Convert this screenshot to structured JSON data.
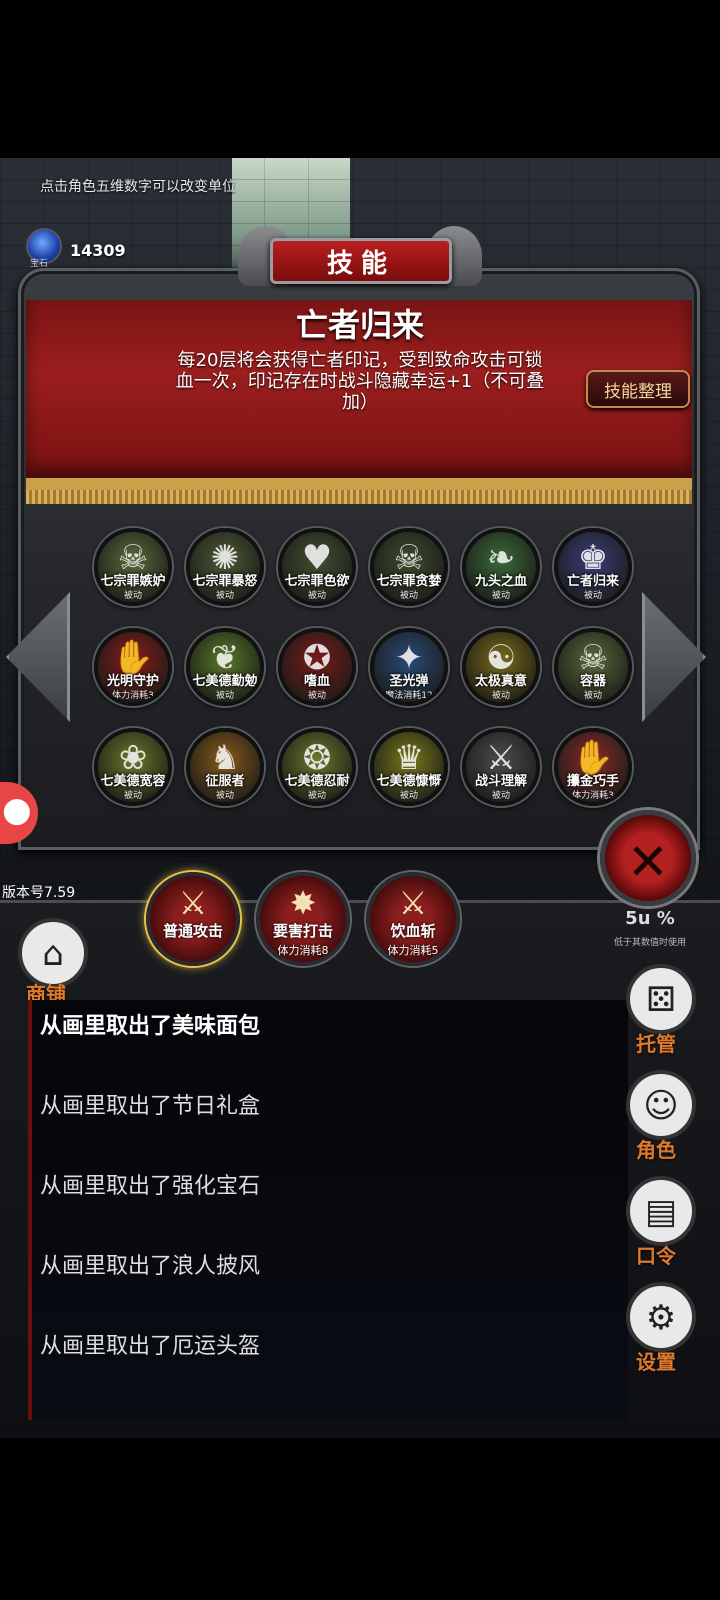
{
  "hint": "点击角色五维数字可以改变单位",
  "currency": {
    "label": "宝石",
    "amount": "14309",
    "icon": "gem-icon"
  },
  "panel": {
    "title": "技能",
    "skill_name": "亡者归来",
    "skill_desc": "每20层将会获得亡者印记，受到致命攻击可锁血一次，印记存在时战斗隐藏幸运+1（不可叠加）",
    "sort_button": "技能整理"
  },
  "skills": [
    {
      "name": "七宗罪嫉妒",
      "sub": "被动",
      "glyph": "☠",
      "color": "#5a6a3a"
    },
    {
      "name": "七宗罪暴怒",
      "sub": "被动",
      "glyph": "✺",
      "color": "#4f5a35"
    },
    {
      "name": "七宗罪色欲",
      "sub": "被动",
      "glyph": "♥",
      "color": "#445030"
    },
    {
      "name": "七宗罪贪婪",
      "sub": "被动",
      "glyph": "☠",
      "color": "#3e4a2e"
    },
    {
      "name": "九头之血",
      "sub": "被动",
      "glyph": "❧",
      "color": "#3a6a3a"
    },
    {
      "name": "亡者归来",
      "sub": "被动",
      "glyph": "♚",
      "color": "#3a3e7a"
    },
    {
      "name": "光明守护",
      "sub": "体力消耗3",
      "glyph": "✋",
      "color": "#8a1a1a"
    },
    {
      "name": "七美德勤勉",
      "sub": "被动",
      "glyph": "❦",
      "color": "#5a7a2a"
    },
    {
      "name": "嗜血",
      "sub": "被动",
      "glyph": "✪",
      "color": "#7a1a1a"
    },
    {
      "name": "圣光弹",
      "sub": "魔法消耗12",
      "glyph": "✦",
      "color": "#2a4a7a"
    },
    {
      "name": "太极真意",
      "sub": "被动",
      "glyph": "☯",
      "color": "#7a6a1a"
    },
    {
      "name": "容器",
      "sub": "被动",
      "glyph": "☠",
      "color": "#5a6a3a"
    },
    {
      "name": "七美德宽容",
      "sub": "被动",
      "glyph": "❀",
      "color": "#6a7a2a"
    },
    {
      "name": "征服者",
      "sub": "被动",
      "glyph": "♞",
      "color": "#8a5a1a"
    },
    {
      "name": "七美德忍耐",
      "sub": "被动",
      "glyph": "❂",
      "color": "#6a7a2a"
    },
    {
      "name": "七美德慷慨",
      "sub": "被动",
      "glyph": "♛",
      "color": "#7a7a1a"
    },
    {
      "name": "战斗理解",
      "sub": "被动",
      "glyph": "⚔",
      "color": "#4a4c50"
    },
    {
      "name": "攥金巧手",
      "sub": "体力消耗3",
      "glyph": "✋",
      "color": "#8a2a2a"
    }
  ],
  "close_icon": "close-icon",
  "version": "版本号7.59",
  "speed": {
    "value": "5u %",
    "sub": "低于其数值时使用"
  },
  "attacks": [
    {
      "name": "普通攻击",
      "sub": "",
      "glyph": "⚔"
    },
    {
      "name": "要害打击",
      "sub": "体力消耗8",
      "glyph": "✸"
    },
    {
      "name": "饮血斩",
      "sub": "体力消耗5",
      "glyph": "⚔"
    }
  ],
  "shop": {
    "label": "商铺",
    "icon": "shop-icon"
  },
  "side_menu": [
    {
      "label": "托管",
      "icon": "dice-icon",
      "glyph": "⚄"
    },
    {
      "label": "角色",
      "icon": "character-icon",
      "glyph": "☺"
    },
    {
      "label": "口令",
      "icon": "book-icon",
      "glyph": "▤"
    },
    {
      "label": "设置",
      "icon": "gear-icon",
      "glyph": "⚙"
    }
  ],
  "logs": [
    "从画里取出了美味面包",
    "从画里取出了节日礼盒",
    "从画里取出了强化宝石",
    "从画里取出了浪人披风",
    "从画里取出了厄运头盔"
  ]
}
